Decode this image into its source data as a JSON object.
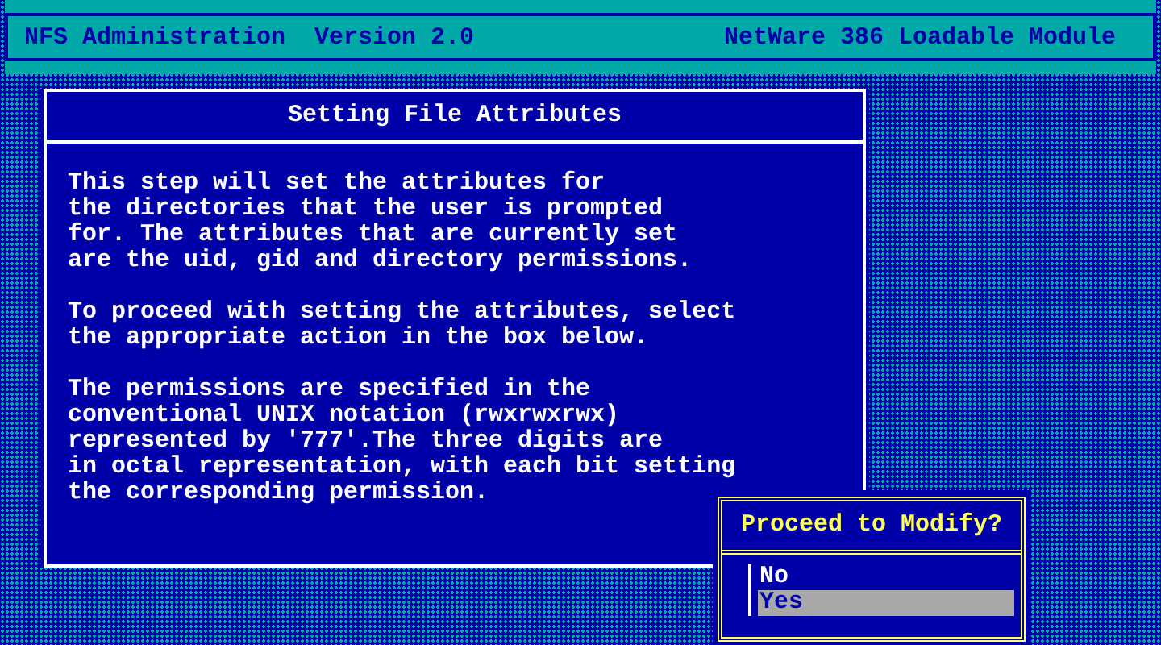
{
  "header": {
    "title": "NFS Administration  Version 2.0",
    "subtitle": "NetWare 386 Loadable Module"
  },
  "dialog": {
    "title": "Setting File Attributes",
    "paragraphs": [
      "This step will set the attributes for\nthe directories that the user is prompted\nfor. The attributes that are currently set\nare the uid, gid and directory permissions.",
      "To proceed with setting the attributes, select\nthe appropriate action in the box below.",
      "The permissions are specified in the\nconventional UNIX notation (rwxrwxrwx)\nrepresented by '777'.The three digits are\nin octal representation, with each bit setting\nthe corresponding permission."
    ]
  },
  "menu": {
    "title": "Proceed to Modify?",
    "items": [
      {
        "label": "No",
        "selected": false
      },
      {
        "label": "Yes",
        "selected": true
      }
    ]
  }
}
